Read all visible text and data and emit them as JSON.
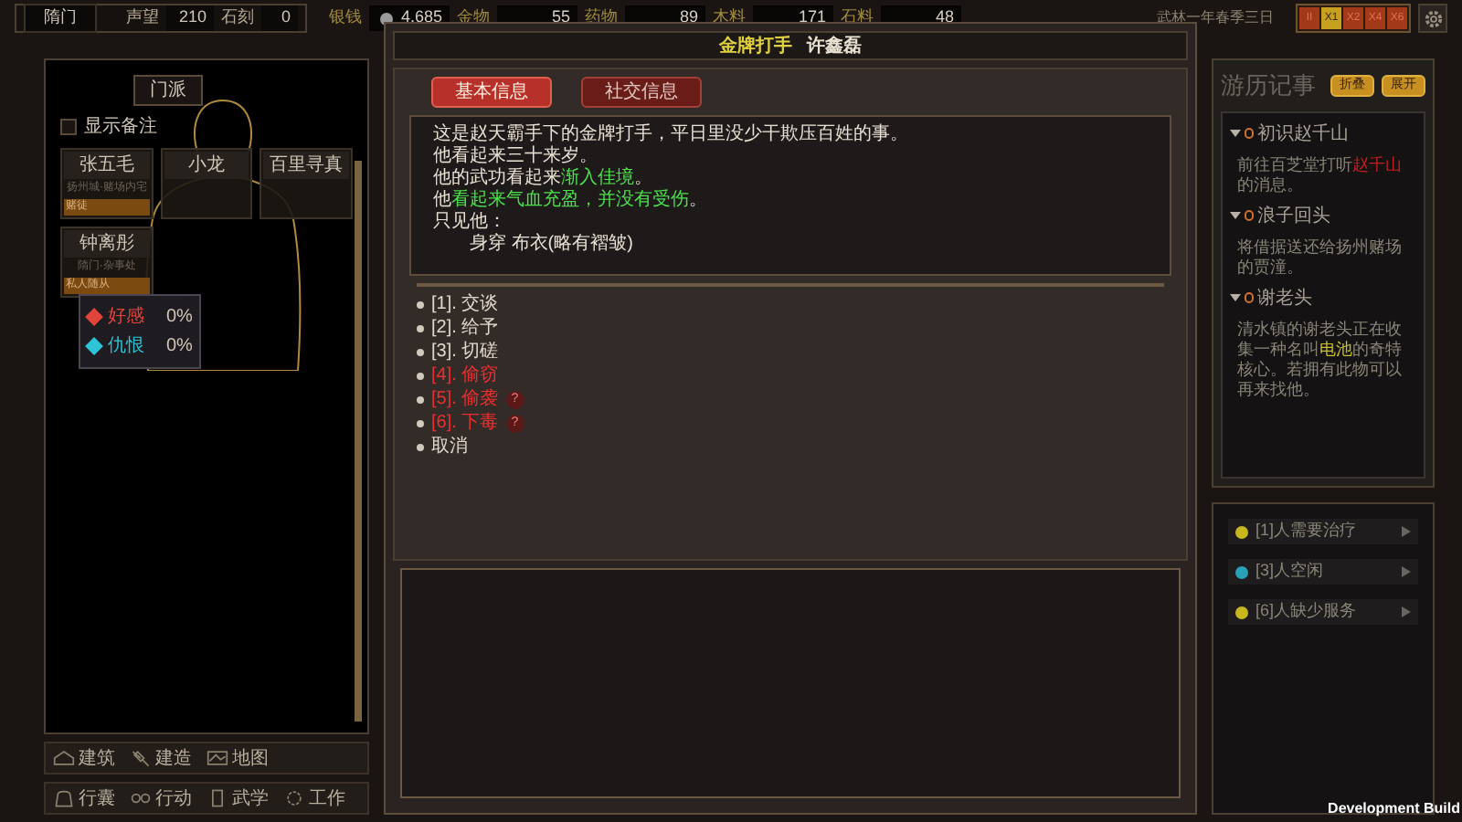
{
  "sect_bar": {
    "sect": "隋门",
    "fame_label": "声望",
    "fame": "210",
    "stone_label": "石刻",
    "stone": "0"
  },
  "resources": [
    {
      "label": "银钱",
      "value": "4,685",
      "coin": true
    },
    {
      "label": "金物",
      "value": "55",
      "coin": false
    },
    {
      "label": "药物",
      "value": "89",
      "coin": false
    },
    {
      "label": "木料",
      "value": "171",
      "coin": false
    },
    {
      "label": "石料",
      "value": "48",
      "coin": false
    }
  ],
  "date": "武林一年春季三日",
  "speed_buttons": [
    {
      "label": "II",
      "selected": false
    },
    {
      "label": "X1",
      "selected": true
    },
    {
      "label": "X2",
      "selected": false
    },
    {
      "label": "X4",
      "selected": false
    },
    {
      "label": "X6",
      "selected": false
    }
  ],
  "left_panel": {
    "tab": "门派",
    "show_notes": {
      "label": "显示备注",
      "checked": false
    },
    "members": [
      {
        "name": "张五毛",
        "place": "扬州城·赌场内宅",
        "tag": "赌徒"
      },
      {
        "name": "小龙"
      },
      {
        "name": "百里寻真"
      },
      {
        "name": "钟离彤",
        "place": "隋门·杂事处",
        "tag": "私人随从"
      }
    ],
    "tooltip": [
      {
        "label": "好感",
        "value": "0%",
        "color": "#e0443a"
      },
      {
        "label": "仇恨",
        "value": "0%",
        "color": "#2ec4d8"
      }
    ]
  },
  "nav_rows": [
    [
      {
        "label": "建筑"
      },
      {
        "label": "建造"
      },
      {
        "label": "地图"
      }
    ],
    [
      {
        "label": "行囊"
      },
      {
        "label": "行动"
      },
      {
        "label": "武学"
      },
      {
        "label": "工作"
      }
    ]
  ],
  "dialog": {
    "title_role": "金牌打手",
    "title_name": "许鑫磊",
    "tabs": [
      {
        "label": "基本信息",
        "selected": true
      },
      {
        "label": "社交信息",
        "selected": false
      }
    ],
    "description": [
      [
        {
          "text": "这是赵天霸手下的金牌打手，平日里没少干欺压百姓的事。",
          "highlight": false
        }
      ],
      [
        {
          "text": "他看起来三十来岁。",
          "highlight": false
        }
      ],
      [
        {
          "text": "他的武功看起来",
          "highlight": false
        },
        {
          "text": "渐入佳境",
          "highlight": true
        },
        {
          "text": "。",
          "highlight": false
        }
      ],
      [
        {
          "text": "他",
          "highlight": false
        },
        {
          "text": "看起来气血充盈，并没有受伤",
          "highlight": true
        },
        {
          "text": "。",
          "highlight": false
        }
      ],
      [
        {
          "text": "只见他：",
          "highlight": false
        }
      ],
      [
        {
          "text": "　　身穿 布衣(略有褶皱)",
          "highlight": false
        }
      ]
    ],
    "options": [
      {
        "label": "[1]. 交谈",
        "hostile": false,
        "uncertain": false
      },
      {
        "label": "[2]. 给予",
        "hostile": false,
        "uncertain": false
      },
      {
        "label": "[3]. 切磋",
        "hostile": false,
        "uncertain": false
      },
      {
        "label": "[4]. 偷窃",
        "hostile": true,
        "uncertain": false
      },
      {
        "label": "[5]. 偷袭",
        "hostile": true,
        "uncertain": true
      },
      {
        "label": "[6]. 下毒",
        "hostile": true,
        "uncertain": true
      },
      {
        "label": "取消",
        "hostile": false,
        "uncertain": false
      }
    ],
    "uncertain_mark": "?"
  },
  "journal": {
    "title": "游历记事",
    "buttons": [
      "折叠",
      "展开"
    ],
    "quests": [
      {
        "title": "初识赵千山",
        "text": [
          {
            "text": "前往百芝堂打听"
          },
          {
            "text": "赵千山",
            "color": "#c02020"
          },
          {
            "text": "的消息。"
          }
        ]
      },
      {
        "title": "浪子回头",
        "text": [
          {
            "text": "将借据送还给扬州赌场的贾潼。"
          }
        ]
      },
      {
        "title": "谢老头",
        "text": [
          {
            "text": "清水镇的谢老头正在收集一种名叫"
          },
          {
            "text": "电池",
            "color": "#c8c030"
          },
          {
            "text": "的奇特核心。若拥有此物可以再来找他。"
          }
        ]
      }
    ]
  },
  "notices": [
    {
      "text": "[1]人需要治疗",
      "color": "#c8b820"
    },
    {
      "text": "[3]人空闲",
      "color": "#2a9fb8"
    },
    {
      "text": "[6]人缺少服务",
      "color": "#c8b820"
    }
  ],
  "build_label": "Development Build"
}
